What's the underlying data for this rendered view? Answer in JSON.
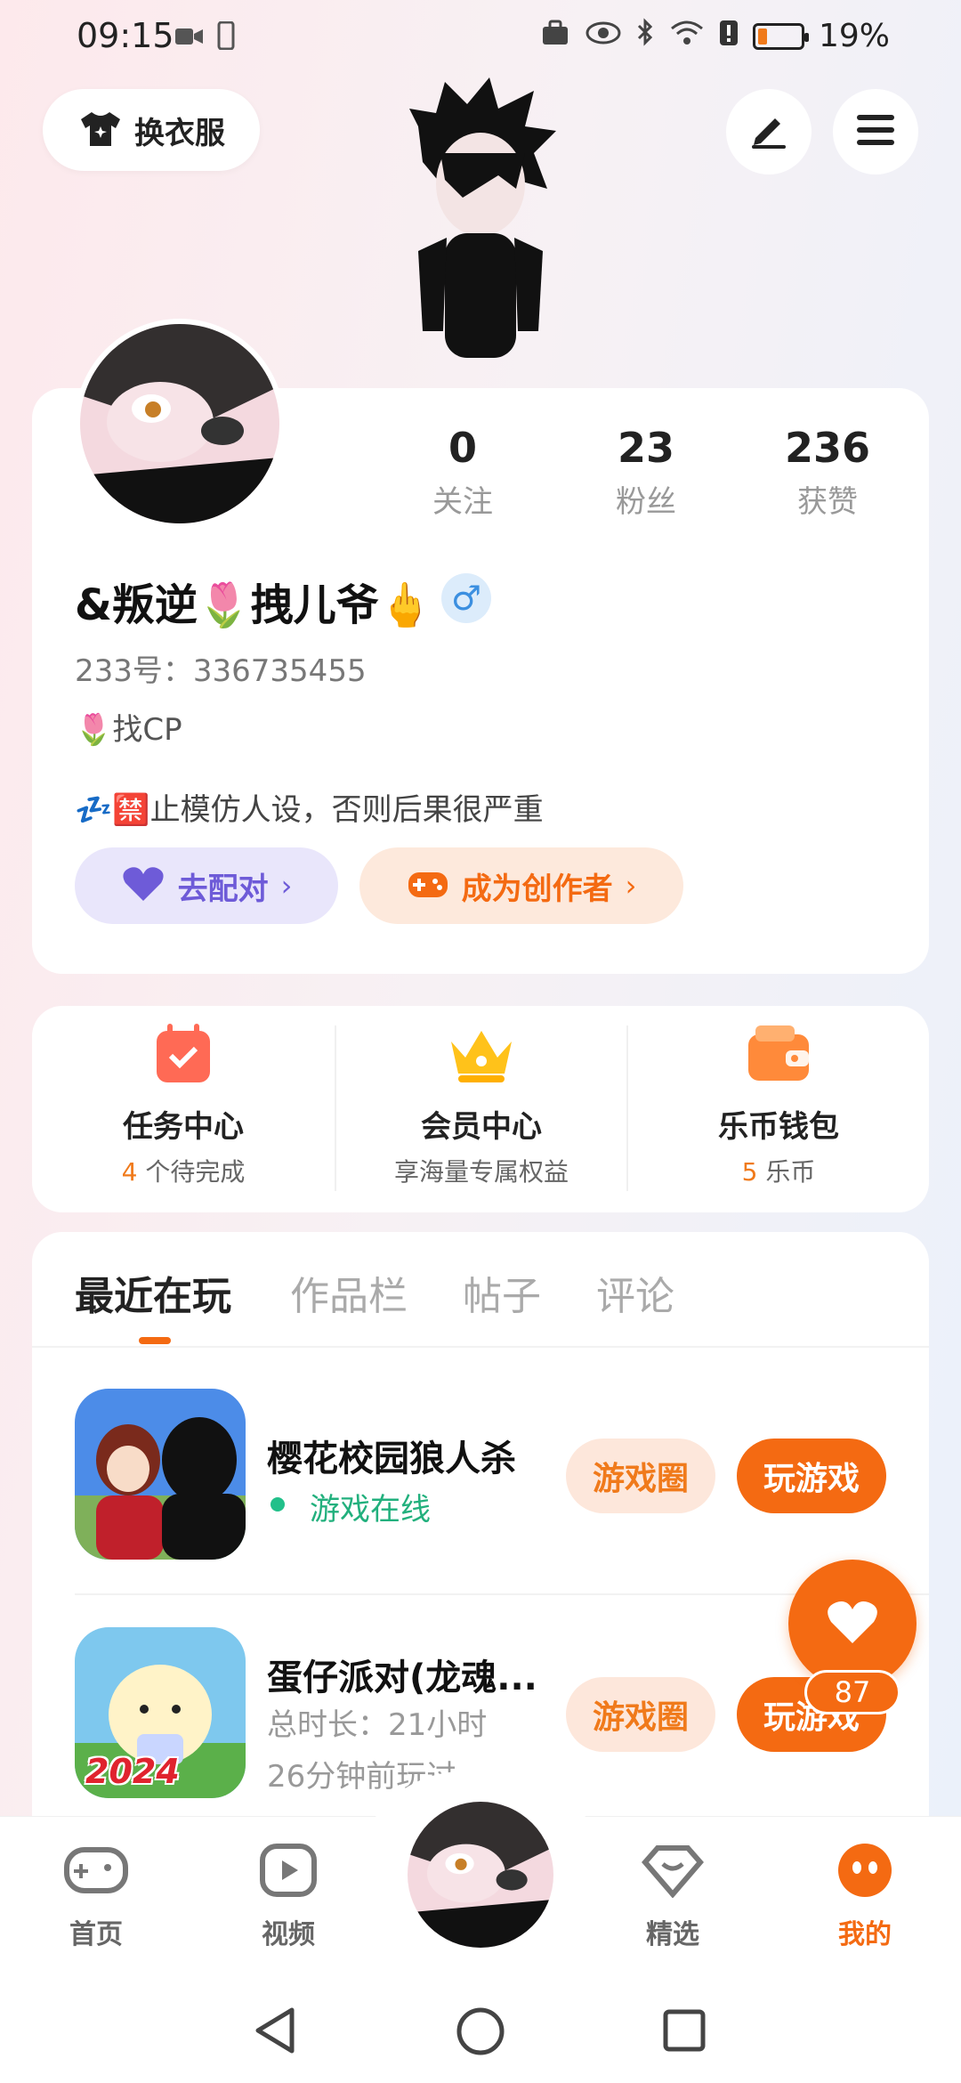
{
  "status_bar": {
    "time": "09:15",
    "battery_percent": "19%",
    "battery_level": 0.19
  },
  "top": {
    "wardrobe_label": "换衣服"
  },
  "profile": {
    "stats": [
      {
        "value": "0",
        "label": "关注"
      },
      {
        "value": "23",
        "label": "粉丝"
      },
      {
        "value": "236",
        "label": "获赞"
      }
    ],
    "nickname": "&叛逆🌷拽儿爷🖕",
    "gender_symbol": "♂",
    "id_line": "233号：336735455",
    "tagline": "🌷找CP",
    "bio": "💤🈲止模仿人设，否则后果很严重",
    "match_label": "去配对",
    "creator_label": "成为创作者"
  },
  "quick": {
    "items": [
      {
        "title": "任务中心",
        "count": "4",
        "sub": "个待完成"
      },
      {
        "title": "会员中心",
        "count": "",
        "sub": "享海量专属权益"
      },
      {
        "title": "乐币钱包",
        "count": "5",
        "sub": "乐币"
      }
    ]
  },
  "tabs": [
    "最近在玩",
    "作品栏",
    "帖子",
    "评论"
  ],
  "games": [
    {
      "title": "樱花校园狼人杀",
      "status": "游戏在线",
      "circle": "游戏圈",
      "play": "玩游戏"
    },
    {
      "title": "蛋仔派对(龙魂...",
      "duration": "总时长：21小时",
      "last": "26分钟前玩过",
      "circle": "游戏圈",
      "play": "玩游戏",
      "icon_text": "2024"
    }
  ],
  "float_like": {
    "count": "87"
  },
  "bottom_nav": {
    "items": [
      "首页",
      "视频",
      "精选",
      "我的"
    ]
  },
  "colors": {
    "accent": "#f46a12",
    "online": "#22b07d",
    "purple": "#6e5bd8"
  }
}
